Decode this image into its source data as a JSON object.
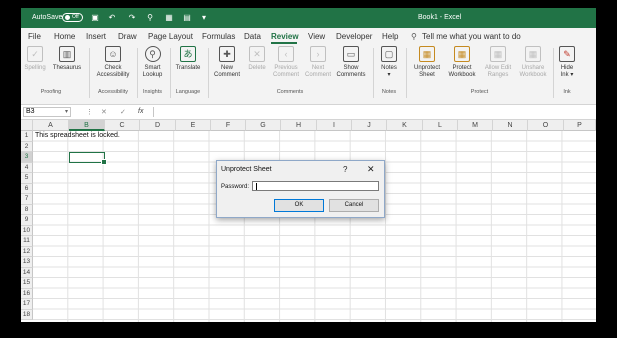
{
  "titlebar": {
    "autosave_label": "AutoSave",
    "autosave_state": "Off",
    "quick_access": [
      "save-icon",
      "undo-icon",
      "redo-icon",
      "paint-icon",
      "customize-icon",
      "box-icon",
      "more-icon"
    ],
    "document_title": "Book1 - Excel",
    "accent": "#217346"
  },
  "menu": {
    "tabs": [
      "File",
      "Home",
      "Insert",
      "Draw",
      "Page Layout",
      "Formulas",
      "Data",
      "Review",
      "View",
      "Developer",
      "Help"
    ],
    "active": "Review",
    "tell_me": "Tell me what you want to do"
  },
  "ribbon": {
    "proofing": {
      "spelling": "Spelling",
      "thesaurus": "Thesaurus",
      "group": "Proofing"
    },
    "accessibility": {
      "check_1": "Check",
      "check_2": "Accessibility",
      "group": "Accessibility"
    },
    "insights": {
      "smart_1": "Smart",
      "smart_2": "Lookup",
      "group": "Insights"
    },
    "language": {
      "translate": "Translate",
      "group": "Language"
    },
    "comments": {
      "new_1": "New",
      "new_2": "Comment",
      "delete": "Delete",
      "prev_1": "Previous",
      "prev_2": "Comment",
      "next_1": "Next",
      "next_2": "Comment",
      "show_1": "Show",
      "show_2": "Comments",
      "group": "Comments"
    },
    "notes": {
      "notes": "Notes",
      "group": "Notes"
    },
    "protect": {
      "unprot_1": "Unprotect",
      "unprot_2": "Sheet",
      "protwb_1": "Protect",
      "protwb_2": "Workbook",
      "allow_1": "Allow Edit",
      "allow_2": "Ranges",
      "unshare_1": "Unshare",
      "unshare_2": "Workbook",
      "group": "Protect"
    },
    "ink": {
      "hide_1": "Hide",
      "hide_2": "Ink",
      "group": "Ink"
    }
  },
  "formula_bar": {
    "name_box": "B3",
    "fx": "fx",
    "cancel": "✕",
    "enter": "✓",
    "value": ""
  },
  "columns": [
    "A",
    "B",
    "C",
    "D",
    "E",
    "F",
    "G",
    "H",
    "I",
    "J",
    "K",
    "L",
    "M",
    "N",
    "O",
    "P"
  ],
  "selected_column": "B",
  "rows": [
    "1",
    "2",
    "3",
    "4",
    "5",
    "6",
    "7",
    "8",
    "9",
    "10",
    "11",
    "12",
    "13",
    "14",
    "15",
    "16",
    "17",
    "18"
  ],
  "cells": {
    "A1": "This spreadsheet is locked."
  },
  "dialog": {
    "title": "Unprotect Sheet",
    "help": "?",
    "close": "✕",
    "password_label": "Password:",
    "password_value": "",
    "ok": "OK",
    "cancel": "Cancel"
  }
}
